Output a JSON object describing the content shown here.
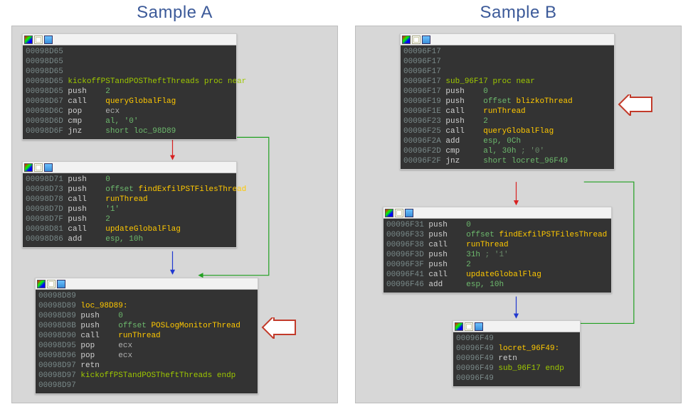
{
  "sampleA": {
    "title": "Sample A",
    "block1": {
      "addr1": "00098D65",
      "addr2": "00098D65",
      "addr3": "00098D65",
      "procLine": {
        "addr": "00098D65",
        "proc": "kickoffPSTandPOSTheftThreads",
        "suffix": "proc near"
      },
      "l1": {
        "addr": "00098D65",
        "mnem": "push",
        "arg": "2"
      },
      "l2": {
        "addr": "00098D67",
        "mnem": "call",
        "arg": "queryGlobalFlag"
      },
      "l3": {
        "addr": "00098D6C",
        "mnem": "pop",
        "arg": "ecx"
      },
      "l4": {
        "addr": "00098D6D",
        "mnem": "cmp",
        "arg": "al, '0'"
      },
      "l5": {
        "addr": "00098D6F",
        "mnem": "jnz",
        "arg": "short loc_98D89"
      }
    },
    "block2": {
      "l1": {
        "addr": "00098D71",
        "mnem": "push",
        "arg": "0"
      },
      "l2": {
        "addr": "00098D73",
        "mnem": "push",
        "arg1": "offset",
        "arg2": "findExfilPSTFilesThread"
      },
      "l3": {
        "addr": "00098D78",
        "mnem": "call",
        "arg": "runThread"
      },
      "l4": {
        "addr": "00098D7D",
        "mnem": "push",
        "arg": "'1'"
      },
      "l5": {
        "addr": "00098D7F",
        "mnem": "push",
        "arg": "2"
      },
      "l6": {
        "addr": "00098D81",
        "mnem": "call",
        "arg": "updateGlobalFlag"
      },
      "l7": {
        "addr": "00098D86",
        "mnem": "add",
        "arg": "esp, 10h"
      }
    },
    "block3": {
      "addr0": "00098D89",
      "lbl": {
        "addr": "00098D89",
        "label": "loc_98D89:"
      },
      "l1": {
        "addr": "00098D89",
        "mnem": "push",
        "arg": "0"
      },
      "l2": {
        "addr": "00098D8B",
        "mnem": "push",
        "arg1": "offset",
        "arg2": "POSLogMonitorThread"
      },
      "l3": {
        "addr": "00098D90",
        "mnem": "call",
        "arg": "runThread"
      },
      "l4": {
        "addr": "00098D95",
        "mnem": "pop",
        "arg": "ecx"
      },
      "l5": {
        "addr": "00098D96",
        "mnem": "pop",
        "arg": "ecx"
      },
      "l6": {
        "addr": "00098D97",
        "mnem": "retn"
      },
      "end": {
        "addr": "00098D97",
        "proc": "kickoffPSTandPOSTheftThreads",
        "suffix": "endp"
      },
      "addrLast": "00098D97"
    }
  },
  "sampleB": {
    "title": "Sample B",
    "block1": {
      "addr1": "00096F17",
      "addr2": "00096F17",
      "addr3": "00096F17",
      "procLine": {
        "addr": "00096F17",
        "proc": "sub_96F17",
        "suffix": "proc near"
      },
      "l1": {
        "addr": "00096F17",
        "mnem": "push",
        "arg": "0"
      },
      "l2": {
        "addr": "00096F19",
        "mnem": "push",
        "arg1": "offset",
        "arg2": "blizkoThread"
      },
      "l3": {
        "addr": "00096F1E",
        "mnem": "call",
        "arg": "runThread"
      },
      "l4": {
        "addr": "00096F23",
        "mnem": "push",
        "arg": "2"
      },
      "l5": {
        "addr": "00096F25",
        "mnem": "call",
        "arg": "queryGlobalFlag"
      },
      "l6": {
        "addr": "00096F2A",
        "mnem": "add",
        "arg": "esp, 0Ch"
      },
      "l7": {
        "addr": "00096F2D",
        "mnem": "cmp",
        "arg": "al, 30h",
        "cmt": "; '0'"
      },
      "l8": {
        "addr": "00096F2F",
        "mnem": "jnz",
        "arg": "short locret_96F49"
      }
    },
    "block2": {
      "l1": {
        "addr": "00096F31",
        "mnem": "push",
        "arg": "0"
      },
      "l2": {
        "addr": "00096F33",
        "mnem": "push",
        "arg1": "offset",
        "arg2": "findExfilPSTFilesThread"
      },
      "l3": {
        "addr": "00096F38",
        "mnem": "call",
        "arg": "runThread"
      },
      "l4": {
        "addr": "00096F3D",
        "mnem": "push",
        "arg": "31h",
        "cmt": "; '1'"
      },
      "l5": {
        "addr": "00096F3F",
        "mnem": "push",
        "arg": "2"
      },
      "l6": {
        "addr": "00096F41",
        "mnem": "call",
        "arg": "updateGlobalFlag"
      },
      "l7": {
        "addr": "00096F46",
        "mnem": "add",
        "arg": "esp, 10h"
      }
    },
    "block3": {
      "addr0": "00096F49",
      "lbl": {
        "addr": "00096F49",
        "label": "locret_96F49:"
      },
      "l1": {
        "addr": "00096F49",
        "mnem": "retn"
      },
      "end": {
        "addr": "00096F49",
        "proc": "sub_96F17",
        "suffix": "endp"
      },
      "addrLast": "00096F49"
    }
  }
}
